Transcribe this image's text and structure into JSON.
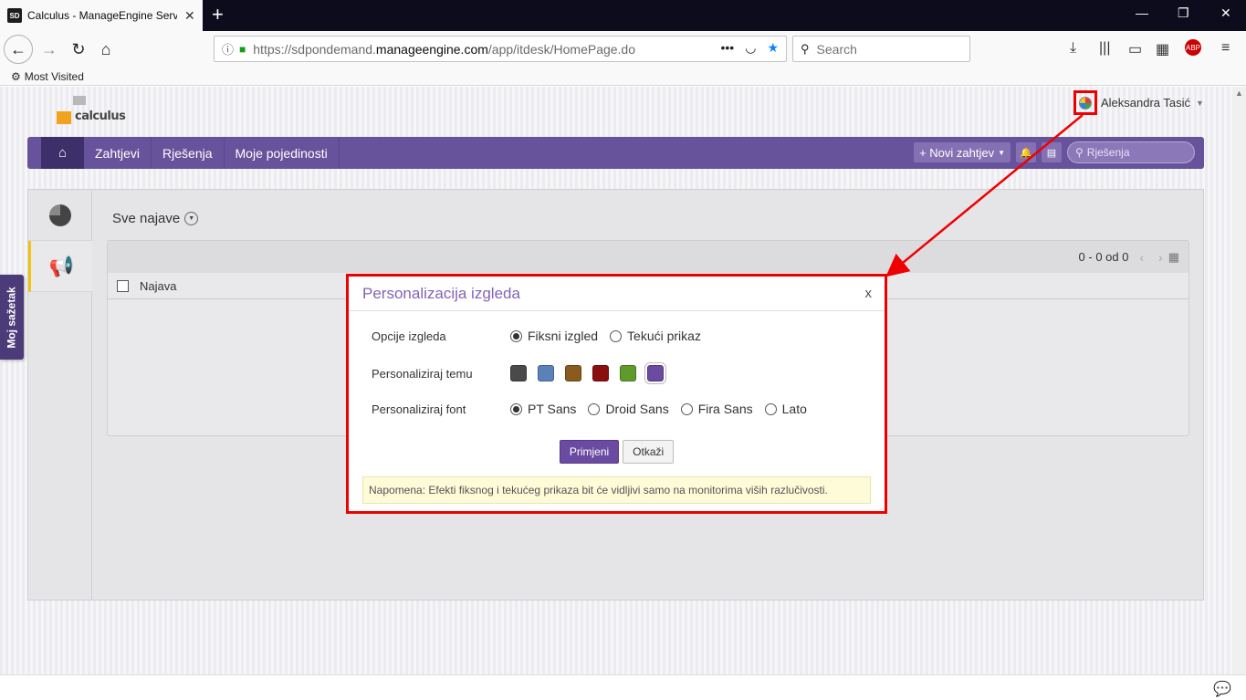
{
  "browser": {
    "tab_title": "Calculus - ManageEngine Servi",
    "tab_favicon": "SD",
    "url_prefix": "https://sdpondemand.",
    "url_domain": "manageengine.com",
    "url_path": "/app/itdesk/HomePage.do",
    "search_placeholder": "Search",
    "bookmark": "Most Visited"
  },
  "header": {
    "logo_text": "calculus",
    "user_name": "Aleksandra Tasić"
  },
  "nav": {
    "items": [
      "Zahtjevi",
      "Rješenja",
      "Moje pojedinosti"
    ],
    "new_request": "+ Novi zahtjev",
    "search_placeholder": "Rješenja"
  },
  "main": {
    "section_title": "Sve najave",
    "pager": "0 - 0 od 0",
    "column": "Najava"
  },
  "side_tab": "Moj sažetak",
  "dialog": {
    "title": "Personalizacija izgleda",
    "close": "x",
    "layout_label": "Opcije izgleda",
    "layout_options": [
      "Fiksni izgled",
      "Tekući prikaz"
    ],
    "layout_selected": 0,
    "theme_label": "Personaliziraj temu",
    "theme_colors": [
      "#4a4a4a",
      "#5b82b8",
      "#8a5a1e",
      "#8b0f0f",
      "#5f9b2a",
      "#6b4aa2"
    ],
    "theme_selected": 5,
    "font_label": "Personaliziraj font",
    "font_options": [
      "PT Sans",
      "Droid Sans",
      "Fira Sans",
      "Lato"
    ],
    "font_selected": 0,
    "apply": "Primjeni",
    "cancel": "Otkaži",
    "note": "Napomena: Efekti fiksnog i tekućeg prikaza bit će vidljivi samo na monitorima viših razlučivosti."
  }
}
